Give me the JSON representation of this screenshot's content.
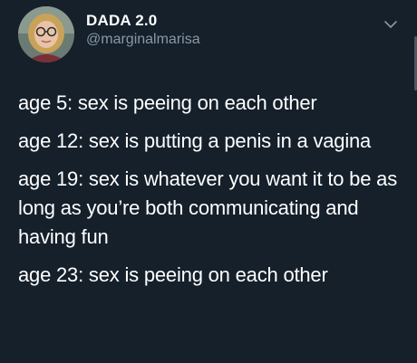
{
  "user": {
    "display_name": "DADA 2.0",
    "handle": "@marginalmarisa",
    "avatar_icon": "profile-photo"
  },
  "caret_icon": "chevron-down-icon",
  "colors": {
    "background": "#15202b",
    "text": "#ffffff",
    "secondary_text": "#8899a6"
  },
  "tweet": {
    "lines": [
      "age 5: sex is peeing on each other",
      "age 12: sex is putting a penis in a vagina",
      "age 19: sex is whatever you want it to be as long as you’re both communicating and having fun",
      "age 23: sex is peeing on each other"
    ]
  }
}
